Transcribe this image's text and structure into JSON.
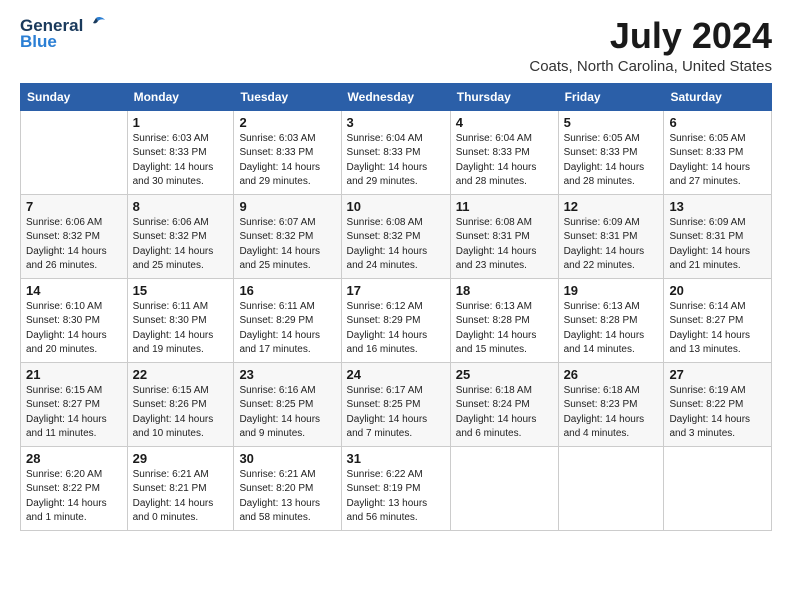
{
  "header": {
    "logo_general": "General",
    "logo_blue": "Blue",
    "month_year": "July 2024",
    "location": "Coats, North Carolina, United States"
  },
  "weekdays": [
    "Sunday",
    "Monday",
    "Tuesday",
    "Wednesday",
    "Thursday",
    "Friday",
    "Saturday"
  ],
  "weeks": [
    [
      {
        "day": "",
        "info": ""
      },
      {
        "day": "1",
        "info": "Sunrise: 6:03 AM\nSunset: 8:33 PM\nDaylight: 14 hours\nand 30 minutes."
      },
      {
        "day": "2",
        "info": "Sunrise: 6:03 AM\nSunset: 8:33 PM\nDaylight: 14 hours\nand 29 minutes."
      },
      {
        "day": "3",
        "info": "Sunrise: 6:04 AM\nSunset: 8:33 PM\nDaylight: 14 hours\nand 29 minutes."
      },
      {
        "day": "4",
        "info": "Sunrise: 6:04 AM\nSunset: 8:33 PM\nDaylight: 14 hours\nand 28 minutes."
      },
      {
        "day": "5",
        "info": "Sunrise: 6:05 AM\nSunset: 8:33 PM\nDaylight: 14 hours\nand 28 minutes."
      },
      {
        "day": "6",
        "info": "Sunrise: 6:05 AM\nSunset: 8:33 PM\nDaylight: 14 hours\nand 27 minutes."
      }
    ],
    [
      {
        "day": "7",
        "info": "Sunrise: 6:06 AM\nSunset: 8:32 PM\nDaylight: 14 hours\nand 26 minutes."
      },
      {
        "day": "8",
        "info": "Sunrise: 6:06 AM\nSunset: 8:32 PM\nDaylight: 14 hours\nand 25 minutes."
      },
      {
        "day": "9",
        "info": "Sunrise: 6:07 AM\nSunset: 8:32 PM\nDaylight: 14 hours\nand 25 minutes."
      },
      {
        "day": "10",
        "info": "Sunrise: 6:08 AM\nSunset: 8:32 PM\nDaylight: 14 hours\nand 24 minutes."
      },
      {
        "day": "11",
        "info": "Sunrise: 6:08 AM\nSunset: 8:31 PM\nDaylight: 14 hours\nand 23 minutes."
      },
      {
        "day": "12",
        "info": "Sunrise: 6:09 AM\nSunset: 8:31 PM\nDaylight: 14 hours\nand 22 minutes."
      },
      {
        "day": "13",
        "info": "Sunrise: 6:09 AM\nSunset: 8:31 PM\nDaylight: 14 hours\nand 21 minutes."
      }
    ],
    [
      {
        "day": "14",
        "info": "Sunrise: 6:10 AM\nSunset: 8:30 PM\nDaylight: 14 hours\nand 20 minutes."
      },
      {
        "day": "15",
        "info": "Sunrise: 6:11 AM\nSunset: 8:30 PM\nDaylight: 14 hours\nand 19 minutes."
      },
      {
        "day": "16",
        "info": "Sunrise: 6:11 AM\nSunset: 8:29 PM\nDaylight: 14 hours\nand 17 minutes."
      },
      {
        "day": "17",
        "info": "Sunrise: 6:12 AM\nSunset: 8:29 PM\nDaylight: 14 hours\nand 16 minutes."
      },
      {
        "day": "18",
        "info": "Sunrise: 6:13 AM\nSunset: 8:28 PM\nDaylight: 14 hours\nand 15 minutes."
      },
      {
        "day": "19",
        "info": "Sunrise: 6:13 AM\nSunset: 8:28 PM\nDaylight: 14 hours\nand 14 minutes."
      },
      {
        "day": "20",
        "info": "Sunrise: 6:14 AM\nSunset: 8:27 PM\nDaylight: 14 hours\nand 13 minutes."
      }
    ],
    [
      {
        "day": "21",
        "info": "Sunrise: 6:15 AM\nSunset: 8:27 PM\nDaylight: 14 hours\nand 11 minutes."
      },
      {
        "day": "22",
        "info": "Sunrise: 6:15 AM\nSunset: 8:26 PM\nDaylight: 14 hours\nand 10 minutes."
      },
      {
        "day": "23",
        "info": "Sunrise: 6:16 AM\nSunset: 8:25 PM\nDaylight: 14 hours\nand 9 minutes."
      },
      {
        "day": "24",
        "info": "Sunrise: 6:17 AM\nSunset: 8:25 PM\nDaylight: 14 hours\nand 7 minutes."
      },
      {
        "day": "25",
        "info": "Sunrise: 6:18 AM\nSunset: 8:24 PM\nDaylight: 14 hours\nand 6 minutes."
      },
      {
        "day": "26",
        "info": "Sunrise: 6:18 AM\nSunset: 8:23 PM\nDaylight: 14 hours\nand 4 minutes."
      },
      {
        "day": "27",
        "info": "Sunrise: 6:19 AM\nSunset: 8:22 PM\nDaylight: 14 hours\nand 3 minutes."
      }
    ],
    [
      {
        "day": "28",
        "info": "Sunrise: 6:20 AM\nSunset: 8:22 PM\nDaylight: 14 hours\nand 1 minute."
      },
      {
        "day": "29",
        "info": "Sunrise: 6:21 AM\nSunset: 8:21 PM\nDaylight: 14 hours\nand 0 minutes."
      },
      {
        "day": "30",
        "info": "Sunrise: 6:21 AM\nSunset: 8:20 PM\nDaylight: 13 hours\nand 58 minutes."
      },
      {
        "day": "31",
        "info": "Sunrise: 6:22 AM\nSunset: 8:19 PM\nDaylight: 13 hours\nand 56 minutes."
      },
      {
        "day": "",
        "info": ""
      },
      {
        "day": "",
        "info": ""
      },
      {
        "day": "",
        "info": ""
      }
    ]
  ]
}
